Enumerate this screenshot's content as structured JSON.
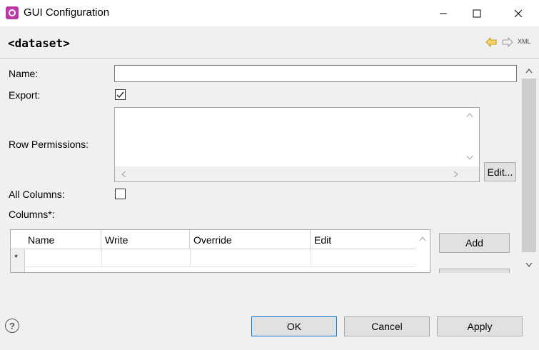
{
  "window": {
    "title": "GUI Configuration",
    "accent": "#b93aa6"
  },
  "header": {
    "element_title": "<dataset>",
    "xml_label": "XML"
  },
  "form": {
    "name_label": "Name:",
    "name_value": "",
    "export_label": "Export:",
    "export_checked": true,
    "row_permissions_label": "Row Permissions:",
    "row_permissions_value": "",
    "edit_button": "Edit...",
    "all_columns_label": "All Columns:",
    "all_columns_checked": false,
    "columns_label": "Columns*:"
  },
  "table": {
    "columns": [
      "Name",
      "Write",
      "Override",
      "Edit"
    ],
    "new_row_marker": "*"
  },
  "side_buttons": {
    "add": "Add"
  },
  "footer": {
    "ok": "OK",
    "cancel": "Cancel",
    "apply": "Apply",
    "help_glyph": "?"
  }
}
